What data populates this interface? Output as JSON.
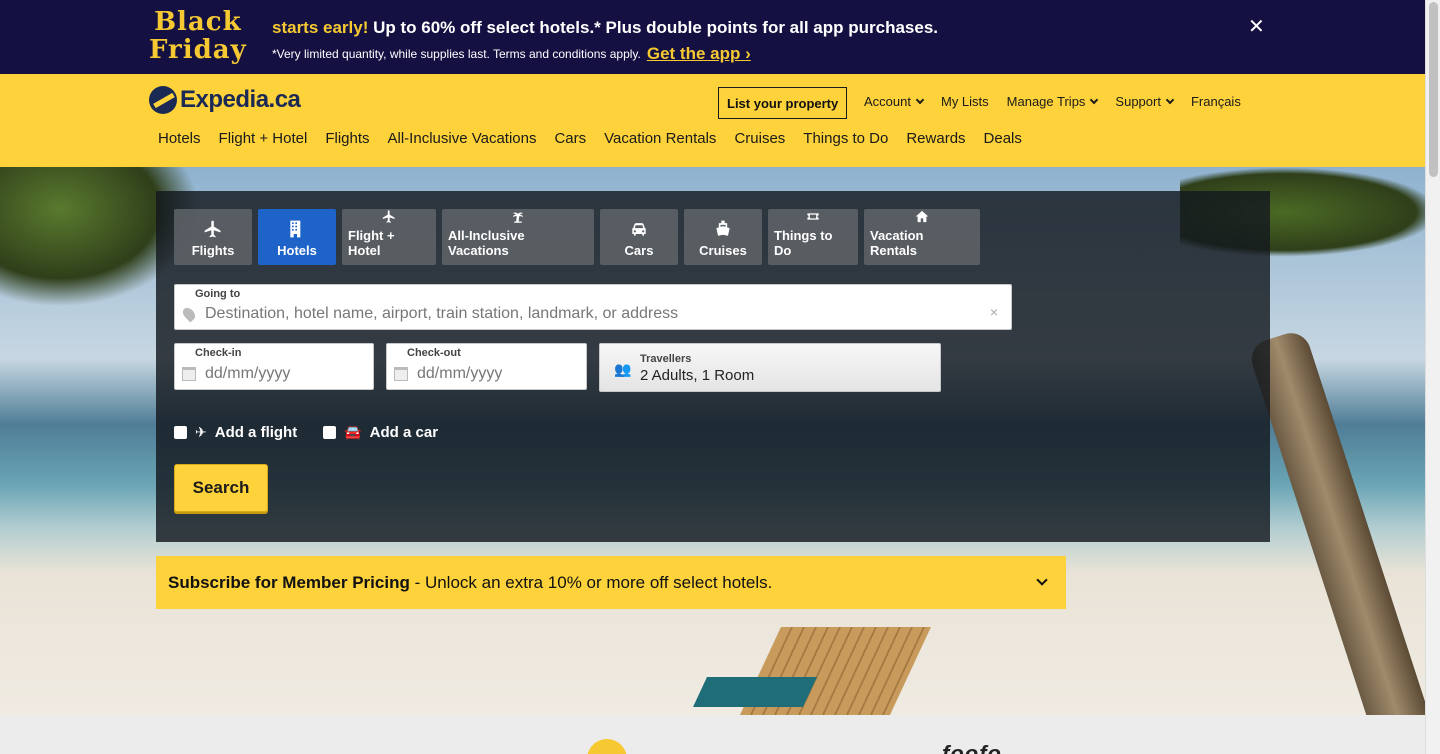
{
  "promo": {
    "logo_line1": "Black",
    "logo_line2": "Friday",
    "highlight": "starts early!",
    "headline": "Up to 60% off select hotels.* Plus double points for all app purchases.",
    "fineprint": "*Very limited quantity, while supplies last. Terms and conditions apply.",
    "cta": "Get the app",
    "cta_arrow": "›",
    "close": "✕"
  },
  "header": {
    "logo_text": "Expedia.ca",
    "list_property": "List your property",
    "top_links": {
      "account": "Account",
      "my_lists": "My Lists",
      "manage_trips": "Manage Trips",
      "support": "Support",
      "language": "Français"
    },
    "nav": [
      "Hotels",
      "Flight + Hotel",
      "Flights",
      "All-Inclusive Vacations",
      "Cars",
      "Vacation Rentals",
      "Cruises",
      "Things to Do",
      "Rewards",
      "Deals"
    ]
  },
  "search": {
    "tabs": [
      {
        "label": "Flights",
        "icon": "plane-icon"
      },
      {
        "label": "Hotels",
        "icon": "building-icon",
        "active": true
      },
      {
        "label": "Flight + Hotel",
        "icon": "plane-building-icon"
      },
      {
        "label": "All-Inclusive Vacations",
        "icon": "palm-tree-icon"
      },
      {
        "label": "Cars",
        "icon": "car-icon"
      },
      {
        "label": "Cruises",
        "icon": "ship-icon"
      },
      {
        "label": "Things to Do",
        "icon": "ticket-icon"
      },
      {
        "label": "Vacation Rentals",
        "icon": "house-icon"
      }
    ],
    "going_to": {
      "label": "Going to",
      "placeholder": "Destination, hotel name, airport, train station, landmark, or address",
      "clear": "×"
    },
    "checkin": {
      "label": "Check-in",
      "placeholder": "dd/mm/yyyy"
    },
    "checkout": {
      "label": "Check-out",
      "placeholder": "dd/mm/yyyy"
    },
    "travellers": {
      "label": "Travellers",
      "value": "2 Adults, 1 Room"
    },
    "add_flight": "Add a flight",
    "add_car": "Add a car",
    "button": "Search"
  },
  "member": {
    "bold": "Subscribe for Member Pricing",
    "text": " - Unlock an extra 10% or more off select hotels."
  },
  "bottom": {
    "partner": "foofo"
  },
  "colors": {
    "brand_yellow": "#fdd23a",
    "promo_navy": "#141142",
    "active_tab": "#1e64c8"
  }
}
